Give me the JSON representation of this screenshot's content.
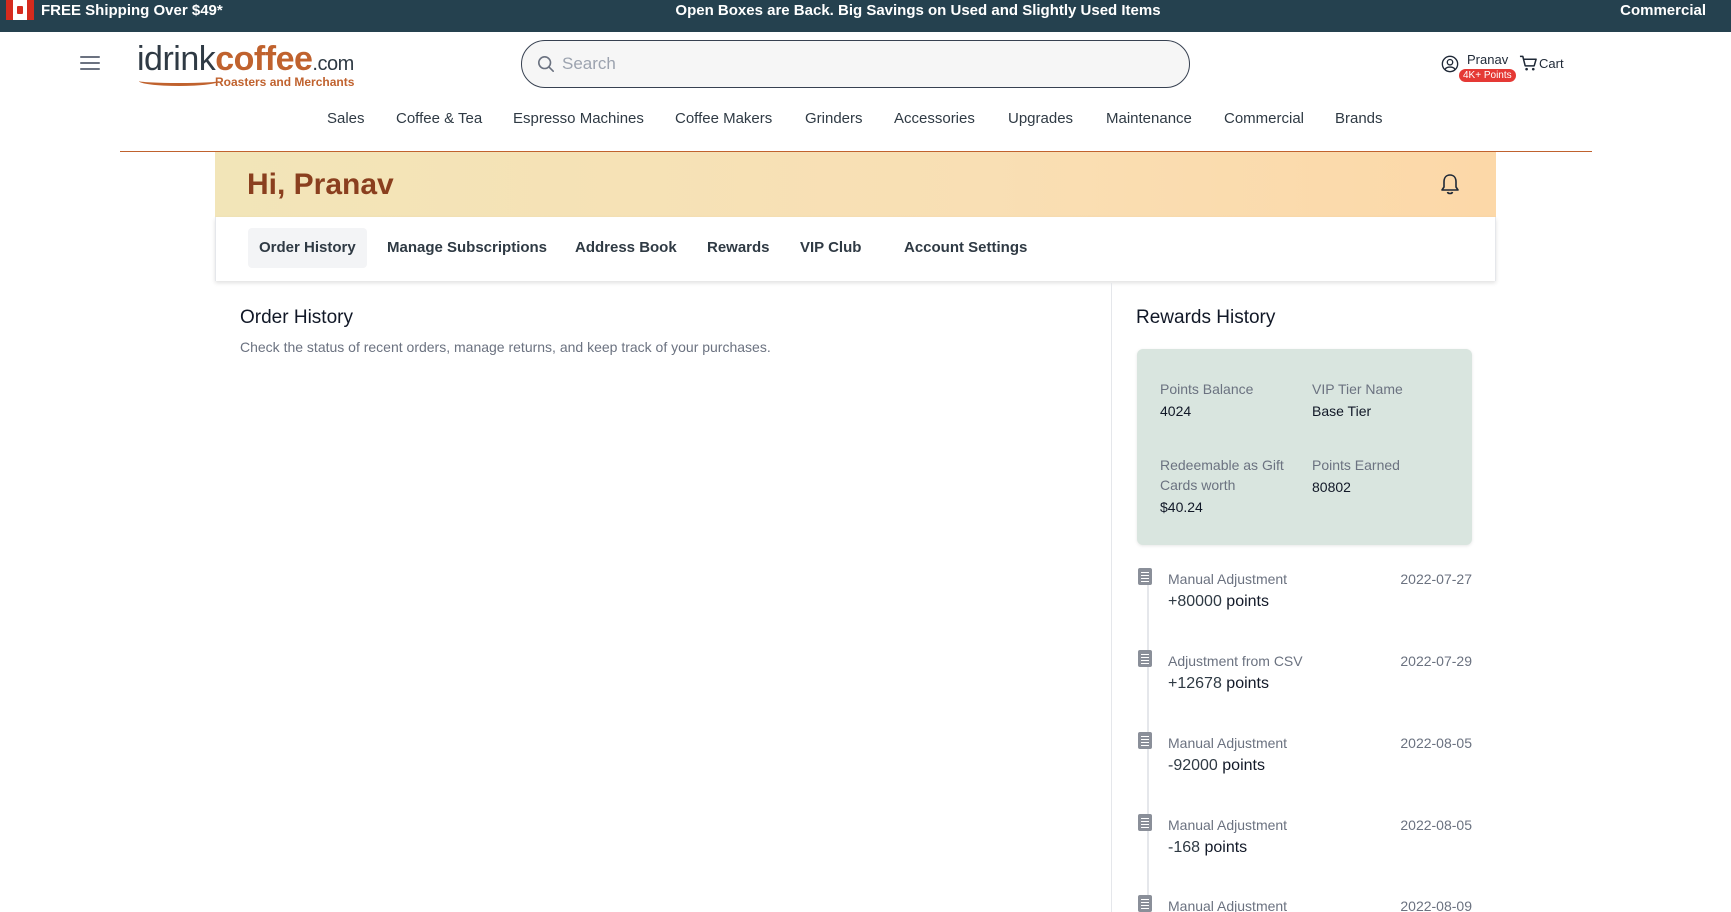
{
  "promo": {
    "left": "FREE Shipping Over $49*",
    "center": "Open Boxes are Back. Big Savings on Used and Slightly Used Items",
    "right": "Commercial"
  },
  "header": {
    "logo": {
      "word_dark": "idrink",
      "word_copper": "coffee",
      "suffix": ".com",
      "tagline": "Roasters and Merchants"
    },
    "search": {
      "placeholder": "Search",
      "value": ""
    },
    "account": {
      "name": "Pranav",
      "badge": "4K+ Points"
    },
    "cart_label": "Cart"
  },
  "nav": [
    "Sales",
    "Coffee & Tea",
    "Espresso Machines",
    "Coffee Makers",
    "Grinders",
    "Accessories",
    "Upgrades",
    "Maintenance",
    "Commercial",
    "Brands"
  ],
  "greeting": "Hi, Pranav",
  "tabs": [
    "Order History",
    "Manage Subscriptions",
    "Address Book",
    "Rewards",
    "VIP Club",
    "Account Settings"
  ],
  "active_tab": "Order History",
  "order_history": {
    "title": "Order History",
    "description": "Check the status of recent orders, manage returns, and keep track of your purchases."
  },
  "rewards": {
    "title": "Rewards History",
    "summary": {
      "points_balance_label": "Points Balance",
      "points_balance": "4024",
      "vip_tier_label": "VIP Tier Name",
      "vip_tier": "Base Tier",
      "redeemable_label": "Redeemable as Gift Cards worth",
      "redeemable": "$40.24",
      "points_earned_label": "Points Earned",
      "points_earned": "80802"
    },
    "entries": [
      {
        "kind": "Manual Adjustment",
        "date": "2022-07-27",
        "amount": "+80000",
        "unit": "points"
      },
      {
        "kind": "Adjustment from CSV",
        "date": "2022-07-29",
        "amount": "+12678",
        "unit": "points"
      },
      {
        "kind": "Manual Adjustment",
        "date": "2022-08-05",
        "amount": "-92000",
        "unit": "points"
      },
      {
        "kind": "Manual Adjustment",
        "date": "2022-08-05",
        "amount": "-168",
        "unit": "points"
      },
      {
        "kind": "Manual Adjustment",
        "date": "2022-08-09",
        "amount": "",
        "unit": ""
      }
    ]
  },
  "icons": {
    "menu": "hamburger-menu-icon",
    "search": "search-icon",
    "account": "user-circle-icon",
    "cart": "cart-icon",
    "bell": "bell-icon",
    "entry": "document-icon",
    "flag": "canada-flag-icon"
  },
  "colors": {
    "promo_bg": "#25414f",
    "brand_copper": "#c0622e",
    "greeting_text": "#8a3f1e",
    "summary_bg": "#d9e5df",
    "badge_red": "#e53935"
  }
}
